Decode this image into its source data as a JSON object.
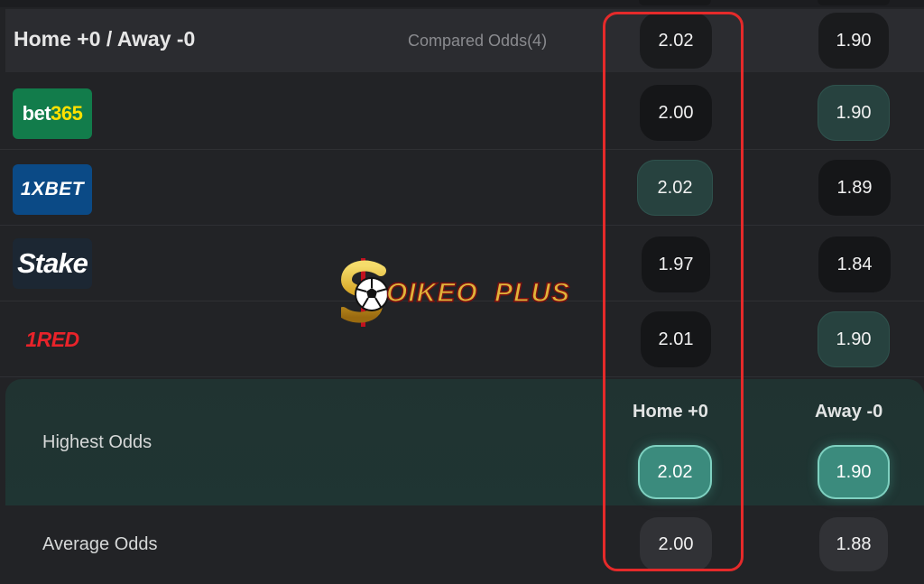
{
  "market": {
    "title": "Home +0 / Away -0",
    "compared_label": "Compared Odds(4)",
    "header_home_odds": "2.02",
    "header_away_odds": "1.90"
  },
  "bookmakers": [
    {
      "name_part1": "bet",
      "name_part2": "365",
      "home": "2.00",
      "away": "1.90",
      "home_highlight": false,
      "away_highlight": true
    },
    {
      "name": "1XBET",
      "home": "2.02",
      "away": "1.89",
      "home_highlight": true,
      "away_highlight": false
    },
    {
      "name": "Stake",
      "home": "1.97",
      "away": "1.84",
      "home_highlight": false,
      "away_highlight": false
    },
    {
      "name": "1RED",
      "home": "2.01",
      "away": "1.90",
      "home_highlight": false,
      "away_highlight": true
    }
  ],
  "summary": {
    "highest_label": "Highest Odds",
    "home_col": "Home +0",
    "away_col": "Away -0",
    "highest_home": "2.02",
    "highest_away": "1.90",
    "average_label": "Average Odds",
    "average_home": "2.00",
    "average_away": "1.88"
  },
  "watermark": {
    "text_main": "OIKEO",
    "text_plus": "PLUS"
  },
  "colors": {
    "highlight_frame": "#e52a2a",
    "best_odds_fill": "#3b8b7d",
    "brand_bet365": "#127c4b",
    "brand_1xbet": "#0b4a86",
    "brand_red": "#e8232a"
  }
}
